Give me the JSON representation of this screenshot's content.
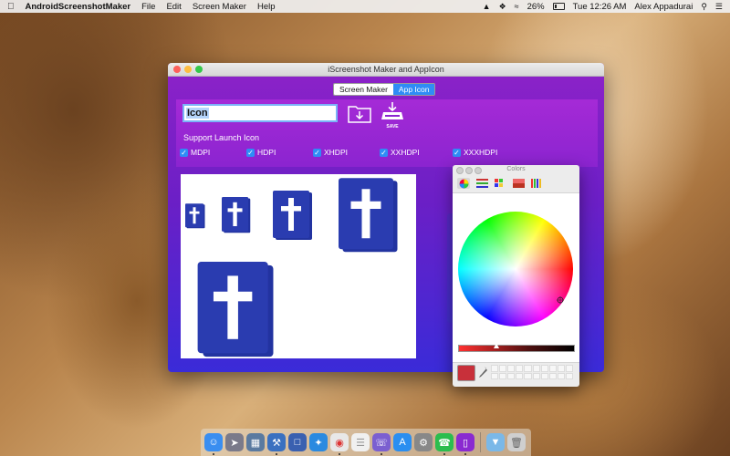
{
  "menubar": {
    "app_name": "AndroidScreenshotMaker",
    "menus": [
      "File",
      "Edit",
      "Screen Maker",
      "Help"
    ],
    "battery_percent": "26%",
    "clock": "Tue 12:26 AM",
    "user": "Alex Appadurai"
  },
  "window": {
    "title": "iScreenshot Maker and AppIcon",
    "tabs": [
      "Screen Maker",
      "App Icon"
    ],
    "active_tab": "App Icon"
  },
  "editor": {
    "name_value": "Icon",
    "save_label": "SAVE",
    "launch_label": "Support Launch Icon",
    "densities": [
      {
        "label": "MDPI",
        "checked": true
      },
      {
        "label": "HDPI",
        "checked": true
      },
      {
        "label": "XHDPI",
        "checked": true
      },
      {
        "label": "XXHDPI",
        "checked": true
      },
      {
        "label": "XXXHDPI",
        "checked": true
      }
    ]
  },
  "colors_panel": {
    "title": "Colors",
    "selected_color": "#c8303a"
  },
  "theme": {
    "accent": "#2f8cf6",
    "gradient_top": "#8e22c8",
    "gradient_bottom": "#3a2bd8",
    "icon_blue": "#2233a0"
  }
}
